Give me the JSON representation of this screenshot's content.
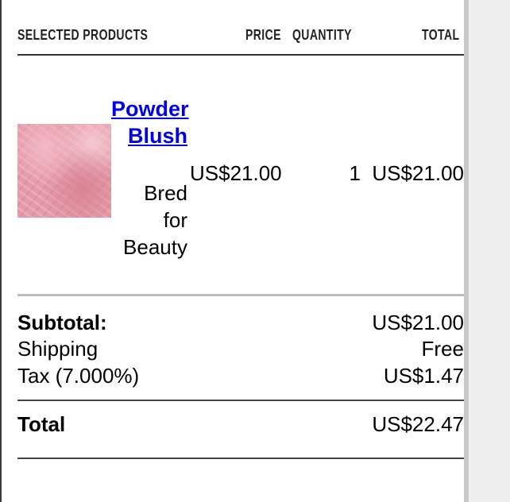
{
  "cart": {
    "columns": {
      "products": "SELECTED PRODUCTS",
      "price": "PRICE",
      "quantity": "QUANTITY",
      "total": "TOTAL"
    },
    "items": [
      {
        "name_line1": "Powder",
        "name_line2": "Blush",
        "brand_line1": "Bred",
        "brand_line2": "for",
        "brand_line3": "Beauty",
        "price": "US$21.00",
        "quantity": "1",
        "total": "US$21.00"
      }
    ],
    "summary": {
      "subtotal_label": "Subtotal:",
      "subtotal_value": "US$21.00",
      "shipping_label": "Shipping",
      "shipping_value": "Free",
      "tax_label": "Tax (7.000%)",
      "tax_value": "US$1.47",
      "total_label": "Total",
      "total_value": "US$22.47"
    }
  },
  "colors": {
    "link": "#0000ee",
    "thumbnail": "#e59aa8"
  }
}
